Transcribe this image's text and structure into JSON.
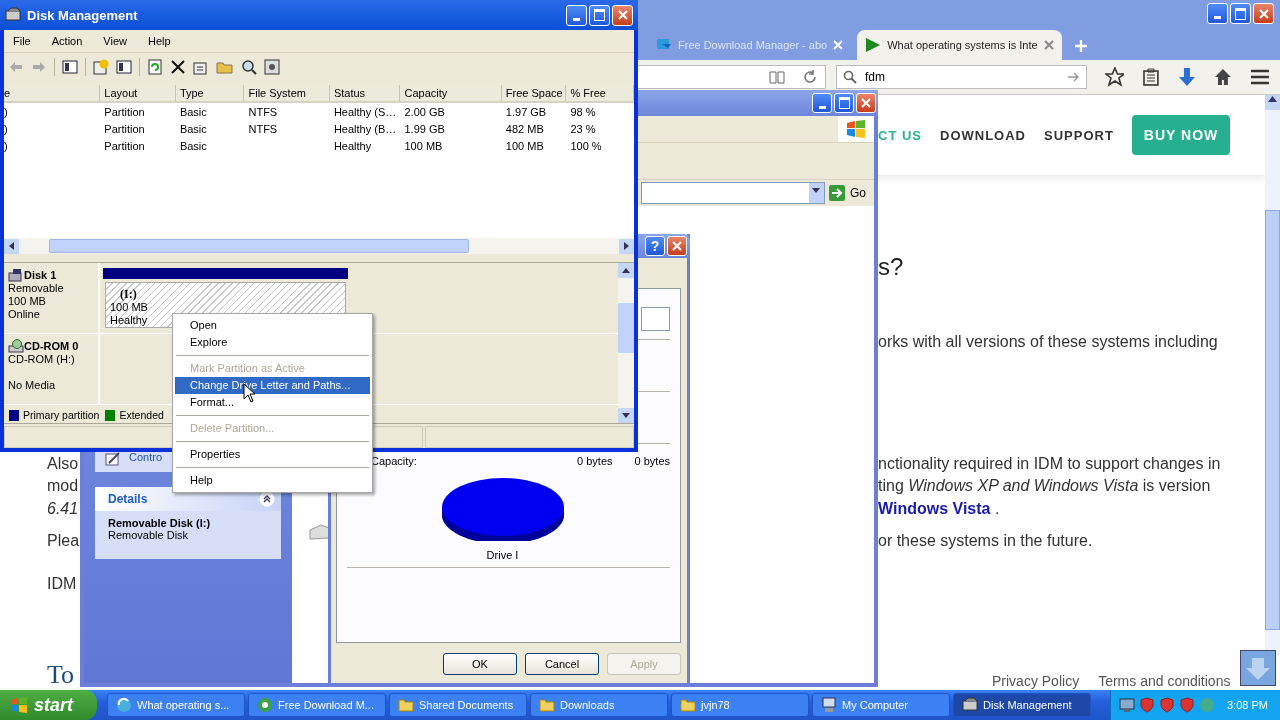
{
  "browser": {
    "tabs": [
      {
        "title": "Free Download Manager - abo",
        "selected": false
      },
      {
        "title": "What operating systems is Inte",
        "selected": true
      }
    ],
    "search": {
      "value": "fdm"
    },
    "nav": [
      {
        "label": "CT US",
        "kind": "current"
      },
      {
        "label": "DOWNLOAD",
        "kind": "link"
      },
      {
        "label": "SUPPORT",
        "kind": "link"
      },
      {
        "label": "BUY NOW",
        "kind": "button"
      }
    ],
    "heading": "s?",
    "paragraphs": [
      {
        "lines": [
          {
            "end": "orks with all versions of these systems including"
          }
        ]
      },
      {
        "lines": [
          {
            "start": "Also",
            "end": "nctionality required in IDM to support changes in"
          },
          {
            "start": "mod",
            "end": "ting *Windows XP and Windows Vista* is version"
          },
          {
            "start": "6.41",
            "start_italic": true,
            "link": "Windows Vista",
            "after": "."
          }
        ]
      },
      {
        "lines": [
          {
            "start": "Plea",
            "end": "or these systems in the future."
          }
        ]
      },
      {
        "lines": [
          {
            "start": "IDM"
          }
        ]
      }
    ],
    "logo": "To",
    "footer_links": [
      "Privacy Policy",
      "Terms and conditions"
    ]
  },
  "explorer": {
    "go": "Go",
    "task_link": "Contro",
    "details": {
      "title": "Details",
      "name": "Removable Disk (I:)",
      "type": "Removable Disk"
    }
  },
  "dialog": {
    "help_button": "?",
    "capacity_label": "Capacity:",
    "capacity_values": [
      "0 bytes",
      "0 bytes"
    ],
    "drive_label": "Drive I",
    "buttons": [
      {
        "label": "OK",
        "disabled": false
      },
      {
        "label": "Cancel",
        "disabled": false
      },
      {
        "label": "Apply",
        "disabled": true
      }
    ]
  },
  "disk_management": {
    "title": "Disk Management",
    "menu": [
      "File",
      "Action",
      "View",
      "Help"
    ],
    "columns": [
      "e",
      "Layout",
      "Type",
      "File System",
      "Status",
      "Capacity",
      "Free Space",
      "% Free"
    ],
    "rows": [
      [
        ")",
        "Partition",
        "Basic",
        "NTFS",
        "Healthy (S…",
        "2.00 GB",
        "1.97 GB",
        "98 %"
      ],
      [
        ")",
        "Partition",
        "Basic",
        "NTFS",
        "Healthy (B…",
        "1.99 GB",
        "482 MB",
        "23 %"
      ],
      [
        ")",
        "Partition",
        "Basic",
        "",
        "Healthy",
        "100 MB",
        "100 MB",
        "100 %"
      ]
    ],
    "disks": [
      {
        "name": "Disk 1",
        "kind": "removable",
        "lines": [
          "Removable",
          "100 MB",
          "Online"
        ],
        "partition": {
          "label": "(I:)",
          "size": "100 MB",
          "status": "Healthy",
          "selected": true
        }
      },
      {
        "name": "CD-ROM 0",
        "kind": "cdrom",
        "lines": [
          "CD-ROM (H:)",
          "No Media"
        ]
      }
    ],
    "legend": [
      {
        "label": "Primary partition",
        "color": "#000080"
      },
      {
        "label": "Extended",
        "color": "#008000"
      }
    ]
  },
  "context_menu": [
    {
      "kind": "item",
      "label": "Open",
      "disabled": false,
      "selected": false
    },
    {
      "kind": "item",
      "label": "Explore",
      "disabled": false,
      "selected": false
    },
    {
      "kind": "separator"
    },
    {
      "kind": "item",
      "label": "Mark Partition as Active",
      "disabled": true,
      "selected": false
    },
    {
      "kind": "item",
      "label": "Change Drive Letter and Paths...",
      "disabled": false,
      "selected": true
    },
    {
      "kind": "item",
      "label": "Format...",
      "disabled": false,
      "selected": false
    },
    {
      "kind": "separator"
    },
    {
      "kind": "item",
      "label": "Delete Partition...",
      "disabled": true,
      "selected": false
    },
    {
      "kind": "separator"
    },
    {
      "kind": "item",
      "label": "Properties",
      "disabled": false,
      "selected": false
    },
    {
      "kind": "separator"
    },
    {
      "kind": "item",
      "label": "Help",
      "disabled": false,
      "selected": false
    }
  ],
  "taskbar": {
    "start": "start",
    "tasks": [
      {
        "label": "What operating s...",
        "kind": "browser",
        "selected": false
      },
      {
        "label": "Free Download M...",
        "kind": "app",
        "selected": false
      },
      {
        "label": "Shared Documents",
        "kind": "folder",
        "selected": false
      },
      {
        "label": "Downloads",
        "kind": "folder",
        "selected": false
      },
      {
        "label": "jvjn78",
        "kind": "folder",
        "selected": false
      },
      {
        "label": "My Computer",
        "kind": "computer",
        "selected": false
      },
      {
        "label": "Disk Management",
        "kind": "disk",
        "selected": true
      }
    ],
    "clock": "3:08 PM"
  }
}
